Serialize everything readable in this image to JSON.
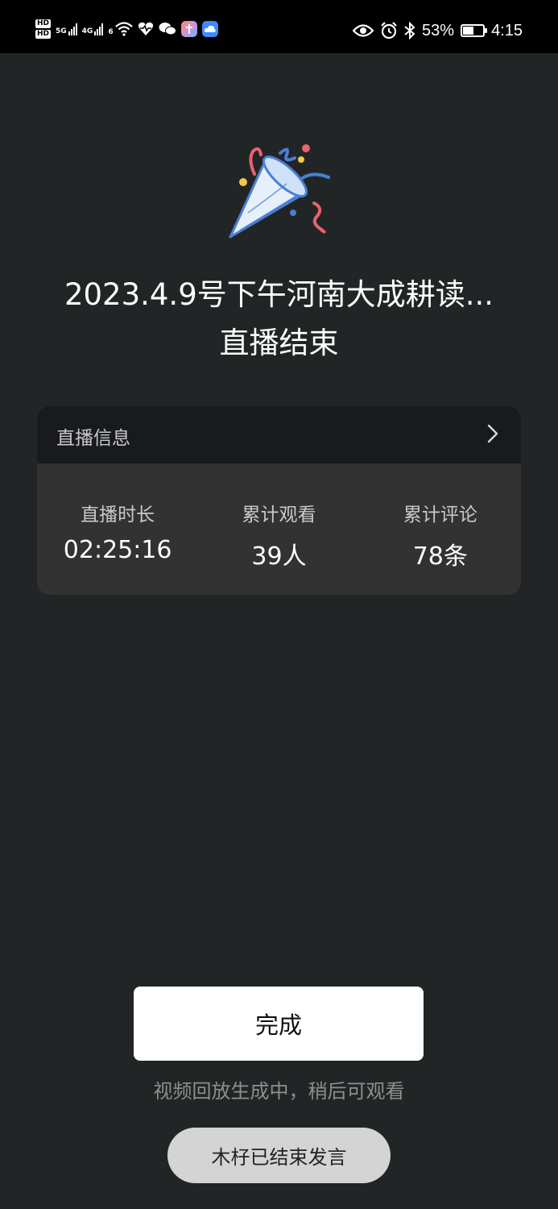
{
  "status_bar": {
    "hd1": "HD",
    "hd2": "HD",
    "net1": "5G",
    "net2": "4G",
    "wifi_label": "6",
    "battery_percent": "53%",
    "battery_level": 0.53,
    "time": "4:15",
    "icons": [
      "signal-icon",
      "wifi-icon",
      "health-icon",
      "wechat-icon",
      "app-icon",
      "cloud-icon",
      "eye-icon",
      "alarm-icon",
      "bluetooth-icon",
      "battery-icon"
    ]
  },
  "main": {
    "title_line1": "2023.4.9号下午河南大成耕读...",
    "title_line2": "直播结束"
  },
  "card": {
    "header_label": "直播信息",
    "stats": [
      {
        "label": "直播时长",
        "value": "02:25:16"
      },
      {
        "label": "累计观看",
        "value": "39人"
      },
      {
        "label": "累计评论",
        "value": "78条"
      }
    ]
  },
  "actions": {
    "done_label": "完成",
    "hint": "视频回放生成中，稍后可观看",
    "speak_ended": "木杍已结束发言"
  },
  "colors": {
    "background": "#222526",
    "card": "#323232",
    "card_header": "#181a1d",
    "accent_blue": "#4a7fd4",
    "accent_red": "#e8626e",
    "accent_yellow": "#f2c94c"
  }
}
